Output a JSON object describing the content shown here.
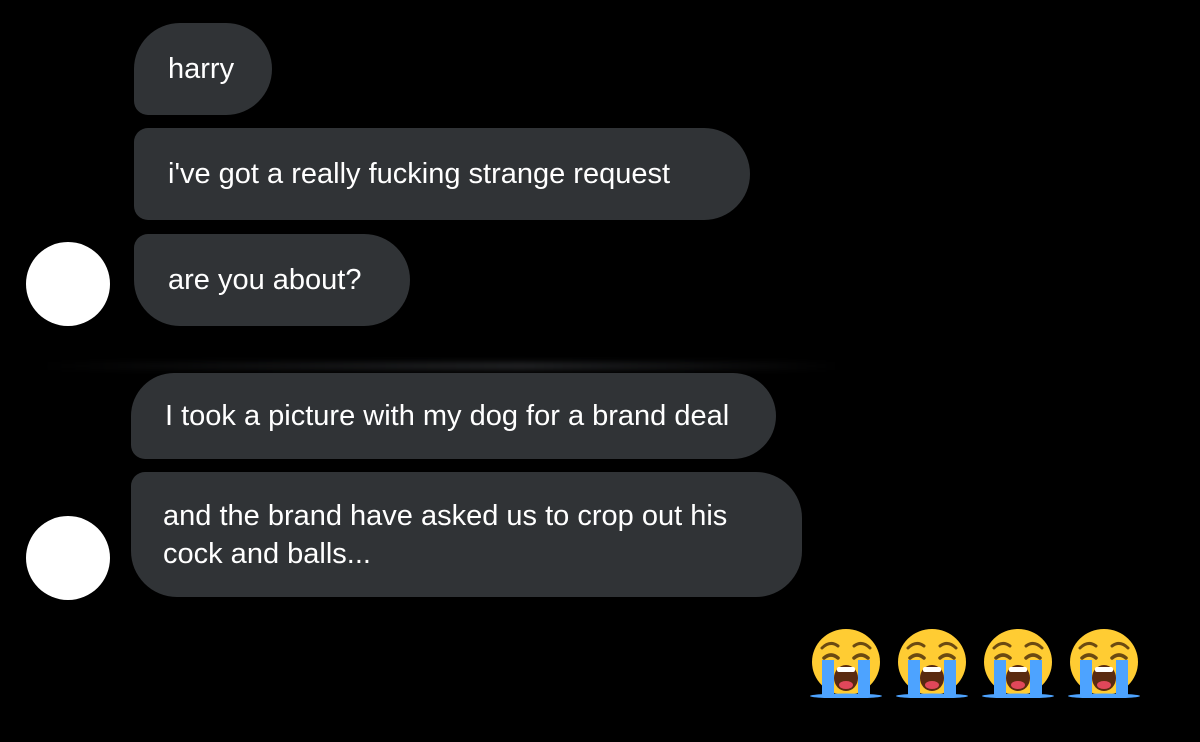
{
  "conversation": {
    "group1": {
      "messages": [
        "harry",
        "i've got a really fucking strange request",
        "are you about?"
      ]
    },
    "group2": {
      "messages": [
        "I took a picture with my dog for a brand deal",
        "and the brand have asked us to crop out his cock and balls..."
      ]
    },
    "reaction": {
      "emoji_icon": "loudly-crying-face-icon",
      "count": 4
    }
  },
  "colors": {
    "background": "#000000",
    "bubble": "#303336",
    "text": "#ffffff",
    "avatar": "#ffffff",
    "emoji_face": "#ffcc33",
    "emoji_tears": "#4da3ff"
  }
}
